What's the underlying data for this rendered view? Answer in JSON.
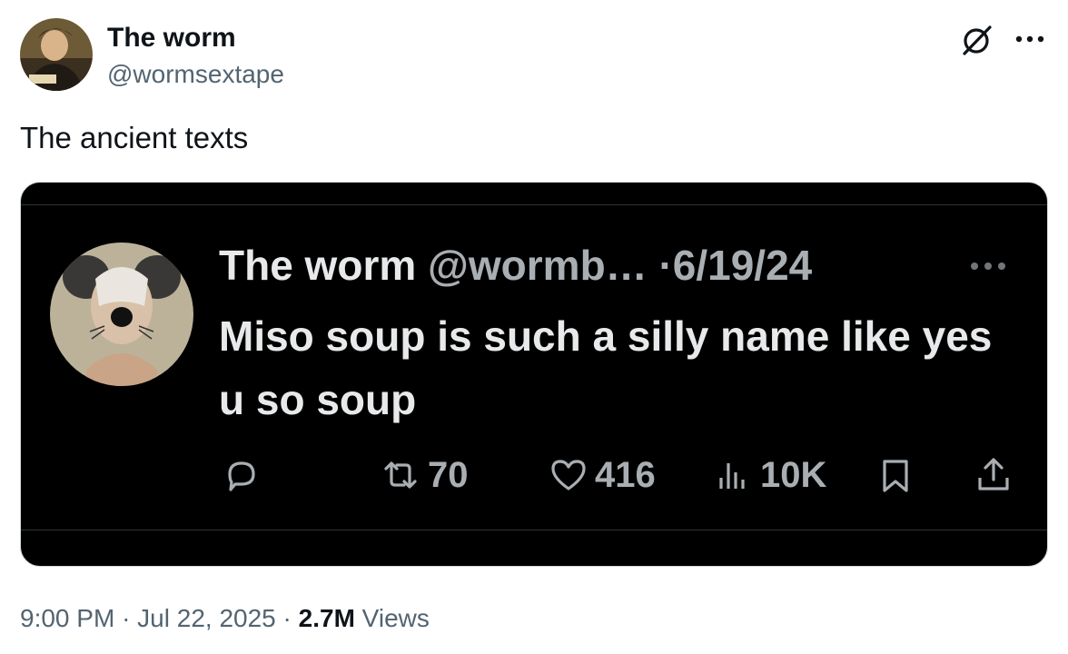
{
  "author": {
    "display_name": "The worm",
    "handle": "@wormsextape"
  },
  "post": {
    "text": "The ancient texts"
  },
  "media": {
    "embedded_post": {
      "display_name": "The worm",
      "handle": "@wormb…",
      "separator": "·",
      "date": "6/19/24",
      "text": "Miso soup is such a silly name like yes u so soup",
      "actions": {
        "reposts": "70",
        "likes": "416",
        "views": "10K"
      }
    }
  },
  "footer": {
    "time": "9:00 PM",
    "date": "Jul 22, 2025",
    "dot": "·",
    "views_count": "2.7M",
    "views_label": "Views"
  },
  "icons": {
    "header": [
      "grok-icon",
      "more-icon"
    ],
    "embedded_actions": [
      "reply-icon",
      "repost-icon",
      "like-icon",
      "views-icon",
      "bookmark-icon",
      "share-icon"
    ]
  },
  "colors": {
    "text_primary": "#0f1419",
    "text_secondary": "#536471",
    "media_background": "#000000",
    "media_text": "#e7e9ea",
    "media_muted": "#a9aeb3",
    "border": "#cfd9de"
  }
}
